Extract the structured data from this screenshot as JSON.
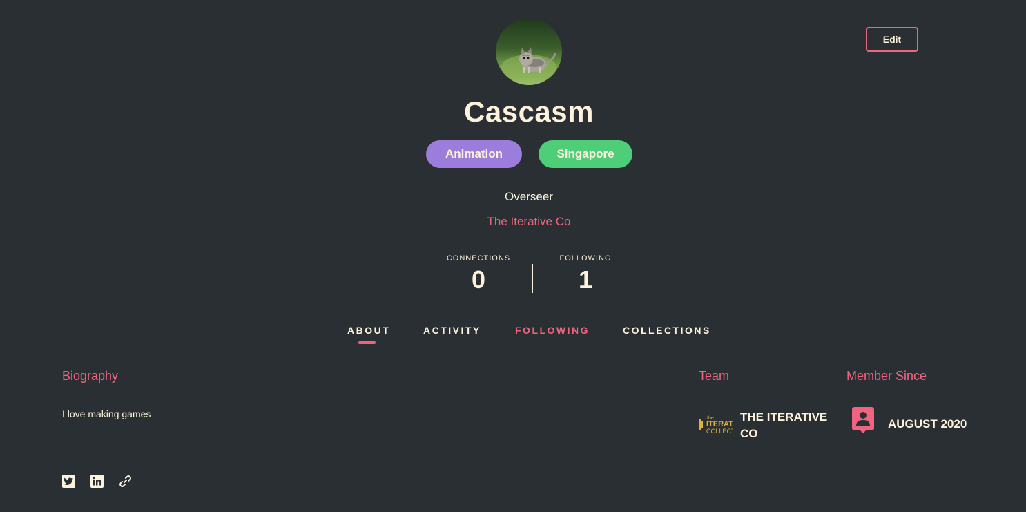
{
  "header": {
    "edit_label": "Edit"
  },
  "profile": {
    "name": "Cascasm",
    "tags": [
      "Animation",
      "Singapore"
    ],
    "role": "Overseer",
    "company": "The Iterative Co"
  },
  "stats": {
    "connections_label": "CONNECTIONS",
    "connections_value": "0",
    "following_label": "FOLLOWING",
    "following_value": "1"
  },
  "tabs": [
    {
      "label": "ABOUT",
      "active": true
    },
    {
      "label": "ACTIVITY",
      "active": false
    },
    {
      "label": "FOLLOWING",
      "active": false
    },
    {
      "label": "COLLECTIONS",
      "active": false
    }
  ],
  "about": {
    "biography_heading": "Biography",
    "biography_text": "I love making games",
    "team_heading": "Team",
    "team_name": "THE ITERATIVE CO",
    "member_since_heading": "Member Since",
    "member_since_value": "AUGUST 2020"
  },
  "social": [
    "twitter-icon",
    "linkedin-icon",
    "link-icon"
  ],
  "colors": {
    "background": "#292f33",
    "accent": "#f0647f",
    "text": "#fdf3dc",
    "tag_animation": "#9d7ddb",
    "tag_location": "#4fce7a"
  }
}
